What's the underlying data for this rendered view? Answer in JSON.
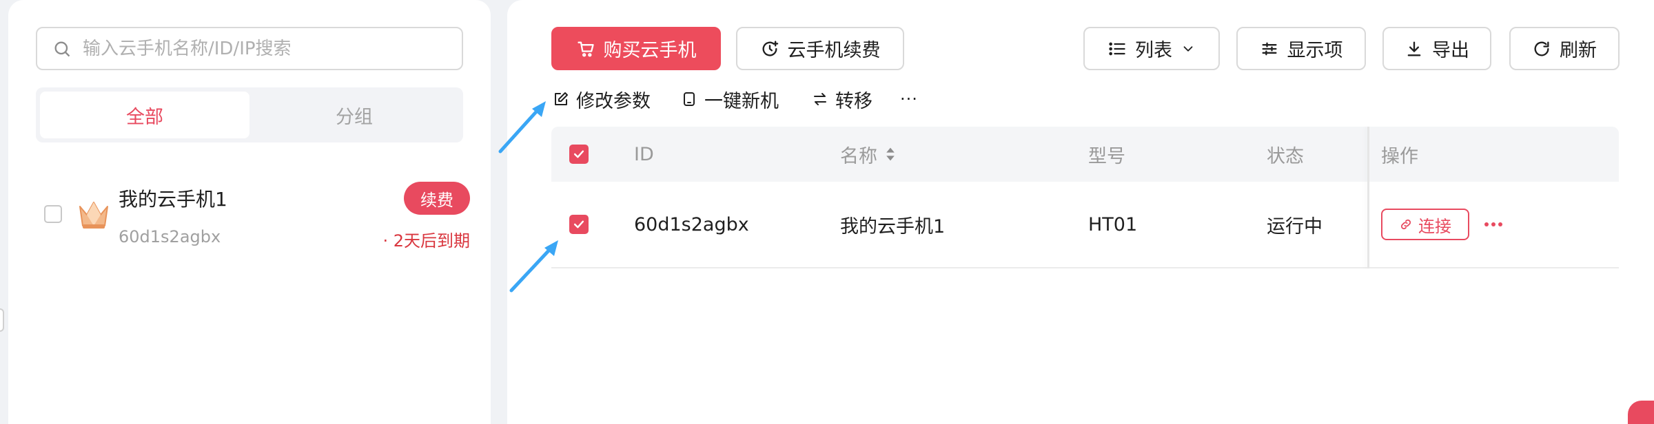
{
  "sidebar": {
    "search_placeholder": "输入云手机名称/ID/IP搜索",
    "tabs": [
      {
        "label": "全部",
        "active": true
      },
      {
        "label": "分组",
        "active": false
      }
    ],
    "devices": [
      {
        "name": "我的云手机1",
        "id": "60d1s2agbx",
        "renew_label": "续费",
        "expire_text": "· 2天后到期",
        "checked": false
      }
    ]
  },
  "toolbar": {
    "buy_label": "购买云手机",
    "renew_label": "云手机续费",
    "view_label": "列表",
    "columns_label": "显示项",
    "export_label": "导出",
    "refresh_label": "刷新"
  },
  "actions": {
    "modify_label": "修改参数",
    "new_device_label": "一键新机",
    "transfer_label": "转移",
    "more_label": "···"
  },
  "table": {
    "headers": {
      "id": "ID",
      "name": "名称",
      "model": "型号",
      "status": "状态",
      "operation": "操作"
    },
    "rows": [
      {
        "id": "60d1s2agbx",
        "name": "我的云手机1",
        "model": "HT01",
        "status": "运行中",
        "connect_label": "连接",
        "checked": true
      }
    ]
  },
  "colors": {
    "accent": "#e84a5f",
    "primary_button": "#ed4c5c",
    "annotation_arrow": "#3aa6f5",
    "expire_text": "#d9363e"
  }
}
